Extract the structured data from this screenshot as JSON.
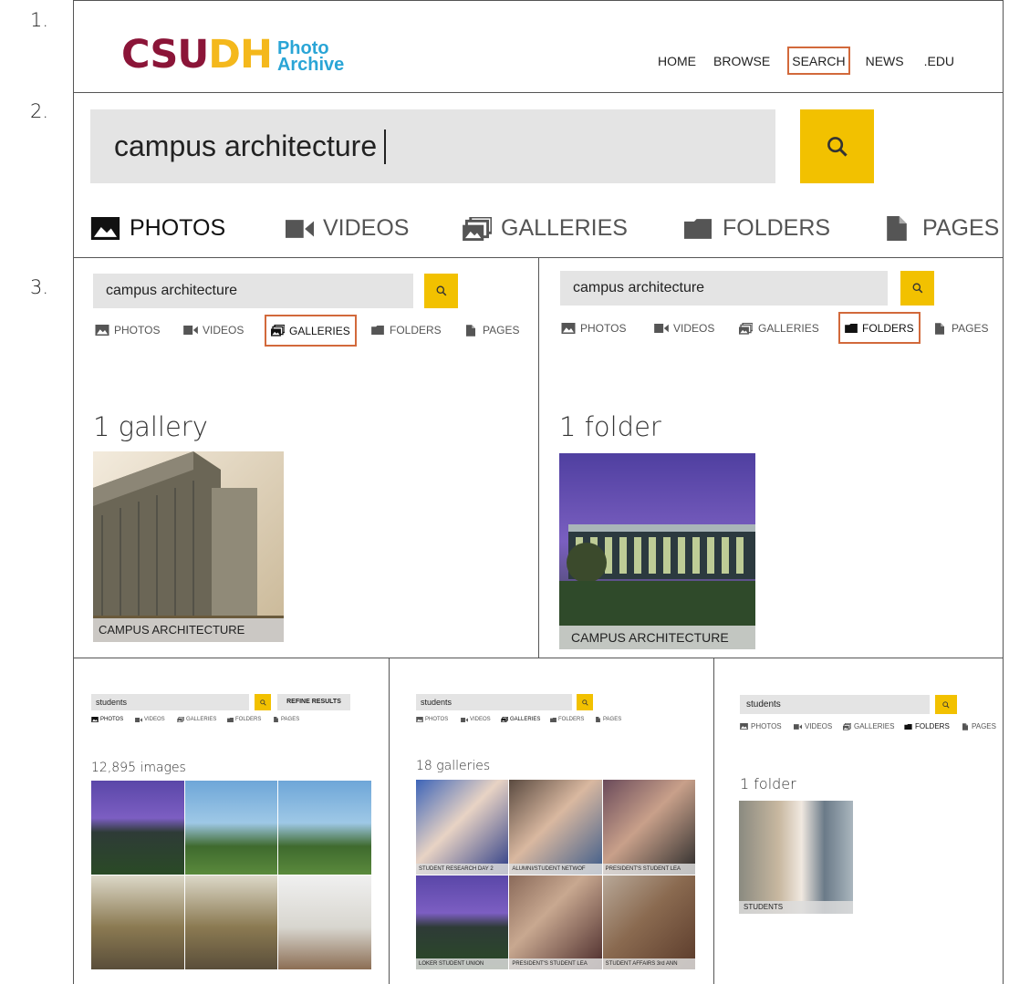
{
  "steps": {
    "s1": "1.",
    "s2": "2.",
    "s3": "3."
  },
  "header": {
    "logo_main": "CSUDH",
    "logo_sub1": "Photo",
    "logo_sub2": "Archive",
    "nav": [
      "HOME",
      "BROWSE",
      "SEARCH",
      "NEWS",
      ".EDU"
    ],
    "active_nav": "SEARCH"
  },
  "big_search": {
    "query": "campus architecture",
    "tabs": [
      "PHOTOS",
      "VIDEOS",
      "GALLERIES",
      "FOLDERS",
      "PAGES"
    ]
  },
  "panel_galleries": {
    "query": "campus architecture",
    "tabs": [
      "PHOTOS",
      "VIDEOS",
      "GALLERIES",
      "FOLDERS",
      "PAGES"
    ],
    "active_tab": "GALLERIES",
    "count": "1 gallery",
    "item_caption": "CAMPUS ARCHITECTURE"
  },
  "panel_folders": {
    "query": "campus architecture",
    "tabs": [
      "PHOTOS",
      "VIDEOS",
      "GALLERIES",
      "FOLDERS",
      "PAGES"
    ],
    "active_tab": "FOLDERS",
    "count": "1 folder",
    "item_caption": "CAMPUS ARCHITECTURE"
  },
  "small_photos": {
    "query": "students",
    "refine": "REFINE RESULTS",
    "tabs": [
      "PHOTOS",
      "VIDEOS",
      "GALLERIES",
      "FOLDERS",
      "PAGES"
    ],
    "count": "12,895 images"
  },
  "small_galleries": {
    "query": "students",
    "tabs": [
      "PHOTOS",
      "VIDEOS",
      "GALLERIES",
      "FOLDERS",
      "PAGES"
    ],
    "count": "18 galleries",
    "captions": [
      "STUDENT RESEARCH DAY 2",
      "ALUMNI/STUDENT NETWOF",
      "PRESIDENT'S STUDENT LEA",
      "LOKER STUDENT UNION",
      "PRESIDENT'S STUDENT LEA",
      "STUDENT AFFAIRS 3rd ANN"
    ]
  },
  "small_folders": {
    "query": "students",
    "tabs": [
      "PHOTOS",
      "VIDEOS",
      "GALLERIES",
      "FOLDERS",
      "PAGES"
    ],
    "count": "1 folder",
    "item_caption": "STUDENTS"
  },
  "colors": {
    "accent": "#f2c100",
    "highlight": "#d2693b",
    "logo_maroon": "#8b1538",
    "logo_gold": "#f4b81c",
    "logo_blue": "#2aa5d6"
  }
}
